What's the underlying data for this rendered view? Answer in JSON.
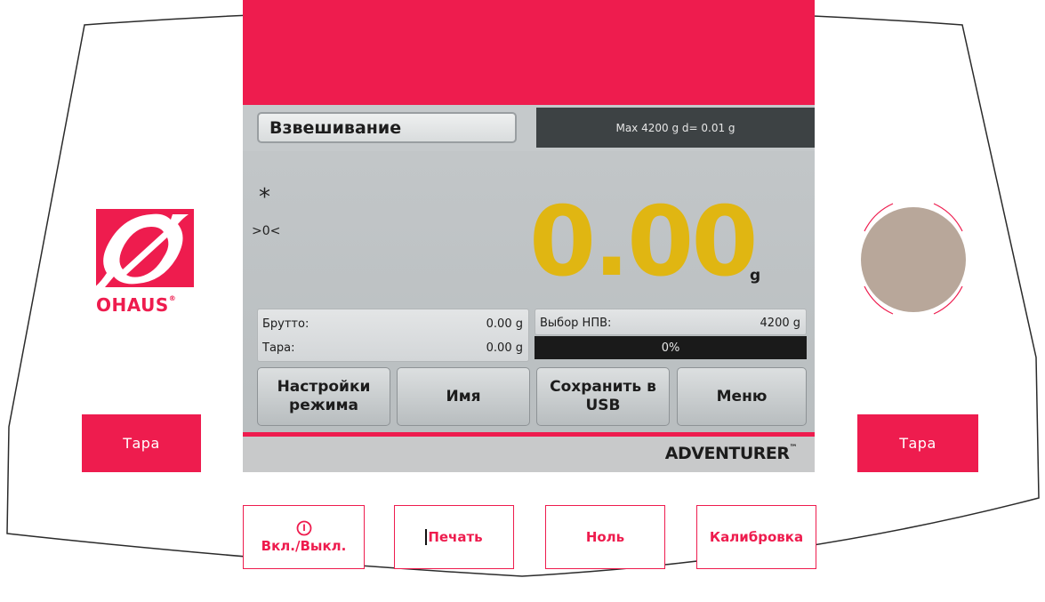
{
  "brand": {
    "name": "OHAUS",
    "mark": "®",
    "model": "ADVENTURER",
    "model_mark": "™"
  },
  "colors": {
    "accent": "#ee1c4e",
    "screen_bg": "#c5c9cb",
    "reading": "#e0b612",
    "knob": "#b8a79a"
  },
  "header": {
    "mode": "Взвешивание",
    "capacity": "Max 4200 g   d= 0.01 g"
  },
  "indicators": {
    "stable": "*",
    "center_zero": ">0<"
  },
  "reading": {
    "value": "0.00",
    "unit": "g"
  },
  "info": {
    "gross_label": "Брутто:",
    "gross_value": "0.00 g",
    "tare_label": "Тара:",
    "tare_value": "0.00 g",
    "capacity_label": "Выбор НПВ:",
    "capacity_value": "4200 g",
    "progress_text": "0%"
  },
  "softkeys": {
    "mode_settings": [
      "Настройки",
      "режима"
    ],
    "name": "Имя",
    "save_usb": [
      "Сохранить в",
      "USB"
    ],
    "menu": "Меню"
  },
  "side_buttons": {
    "left": "Тара",
    "right": "Тара"
  },
  "hard_buttons": {
    "power": "Вкл./Выкл.",
    "print": "Печать",
    "zero": "Ноль",
    "calibration": "Калибровка"
  }
}
